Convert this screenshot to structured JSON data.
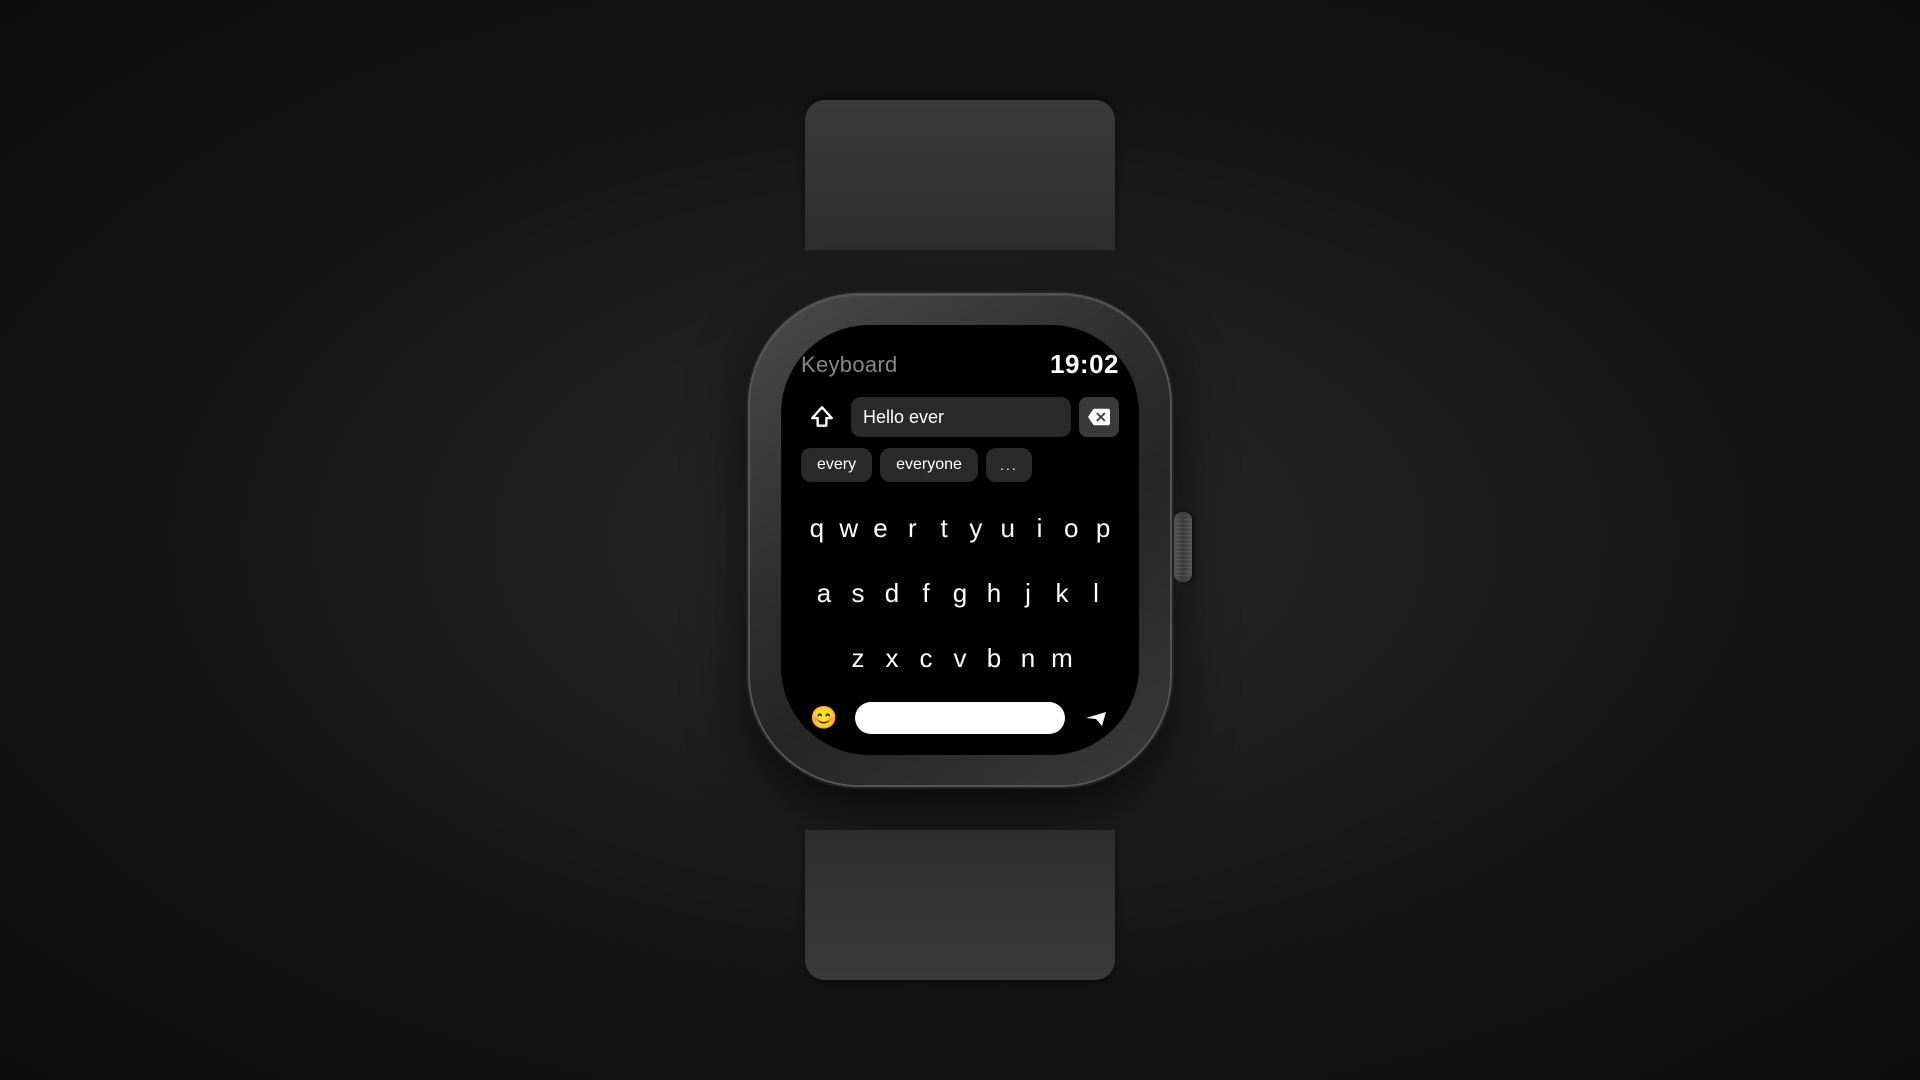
{
  "background": {
    "color": "#1a1a1a"
  },
  "watch": {
    "header": {
      "title": "Keyboard",
      "time": "19:02"
    },
    "text_field": {
      "value": "Hello ever"
    },
    "autocomplete": {
      "options": [
        "every",
        "everyone",
        "..."
      ]
    },
    "keyboard": {
      "row1": [
        "q",
        "w",
        "e",
        "r",
        "t",
        "y",
        "u",
        "i",
        "o",
        "p"
      ],
      "row2": [
        "a",
        "s",
        "d",
        "f",
        "g",
        "h",
        "j",
        "k",
        "l"
      ],
      "row3": [
        "z",
        "x",
        "c",
        "v",
        "b",
        "n",
        "m"
      ]
    },
    "toolbar": {
      "emoji_label": "😊",
      "send_label": "➤"
    }
  }
}
